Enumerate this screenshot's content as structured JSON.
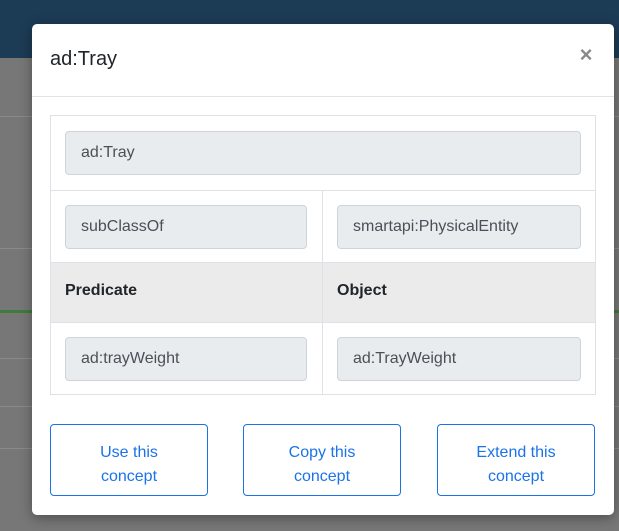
{
  "modal": {
    "title": "ad:Tray",
    "close_glyph": "×"
  },
  "concept": {
    "name": "ad:Tray",
    "relation": {
      "predicate": "subClassOf",
      "object": "smartapi:PhysicalEntity"
    },
    "headers": {
      "predicate": "Predicate",
      "object": "Object"
    },
    "properties": [
      {
        "predicate": "ad:trayWeight",
        "object": "ad:TrayWeight"
      }
    ]
  },
  "actions": {
    "use": {
      "line1": "Use this",
      "line2": "concept"
    },
    "copy": {
      "line1": "Copy this",
      "line2": "concept"
    },
    "extend": {
      "line1": "Extend this",
      "line2": "concept"
    }
  },
  "colors": {
    "accent": "#1a73e8",
    "header_bar": "#1c3b55",
    "overlay": "#777777"
  }
}
